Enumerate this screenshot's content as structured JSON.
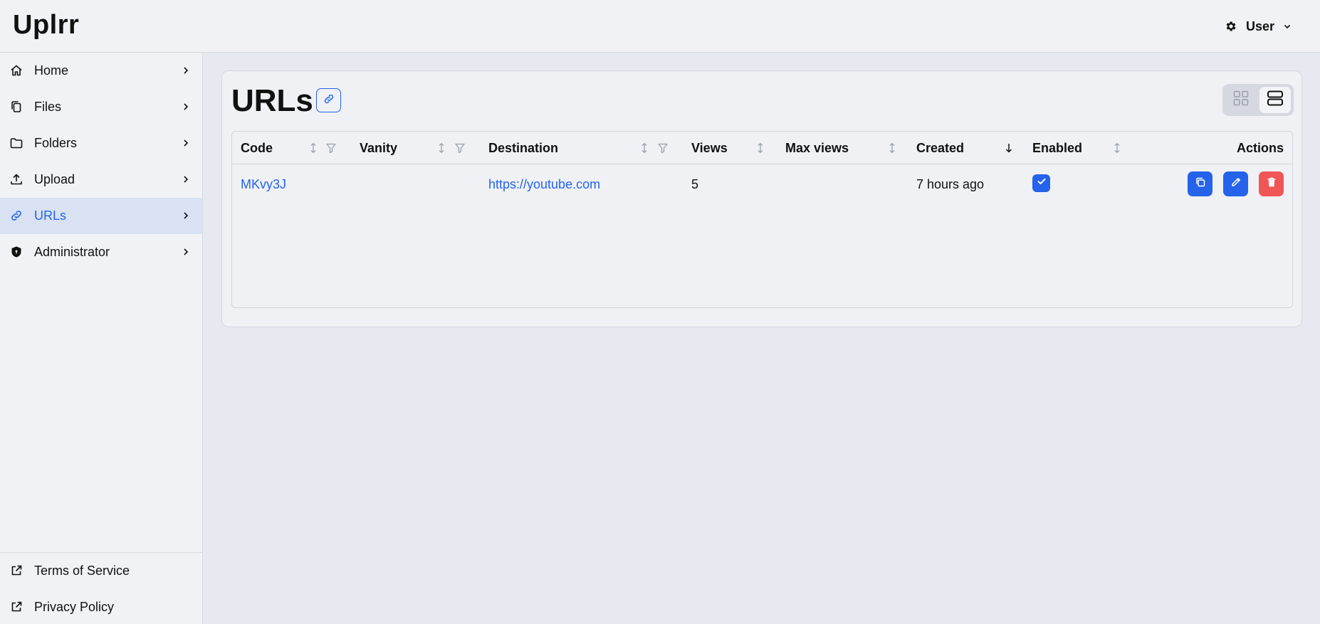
{
  "app": {
    "title": "Uplrr"
  },
  "header": {
    "user_label": "User"
  },
  "sidebar": {
    "items": [
      {
        "label": "Home",
        "icon": "home-icon"
      },
      {
        "label": "Files",
        "icon": "files-icon"
      },
      {
        "label": "Folders",
        "icon": "folder-icon"
      },
      {
        "label": "Upload",
        "icon": "upload-icon"
      },
      {
        "label": "URLs",
        "icon": "link-icon",
        "active": true
      },
      {
        "label": "Administrator",
        "icon": "shield-icon"
      }
    ],
    "footer": [
      {
        "label": "Terms of Service",
        "icon": "external-link-icon"
      },
      {
        "label": "Privacy Policy",
        "icon": "external-link-icon"
      }
    ]
  },
  "page": {
    "title": "URLs"
  },
  "table": {
    "columns": [
      "Code",
      "Vanity",
      "Destination",
      "Views",
      "Max views",
      "Created",
      "Enabled",
      "Actions"
    ],
    "rows": [
      {
        "code": "MKvy3J",
        "vanity": "",
        "destination": "https://youtube.com",
        "views": "5",
        "max_views": "",
        "created": "7 hours ago",
        "enabled": true
      }
    ]
  },
  "colors": {
    "accent": "#2563eb",
    "danger": "#f05656",
    "active_nav_bg": "#d9e2f3"
  }
}
